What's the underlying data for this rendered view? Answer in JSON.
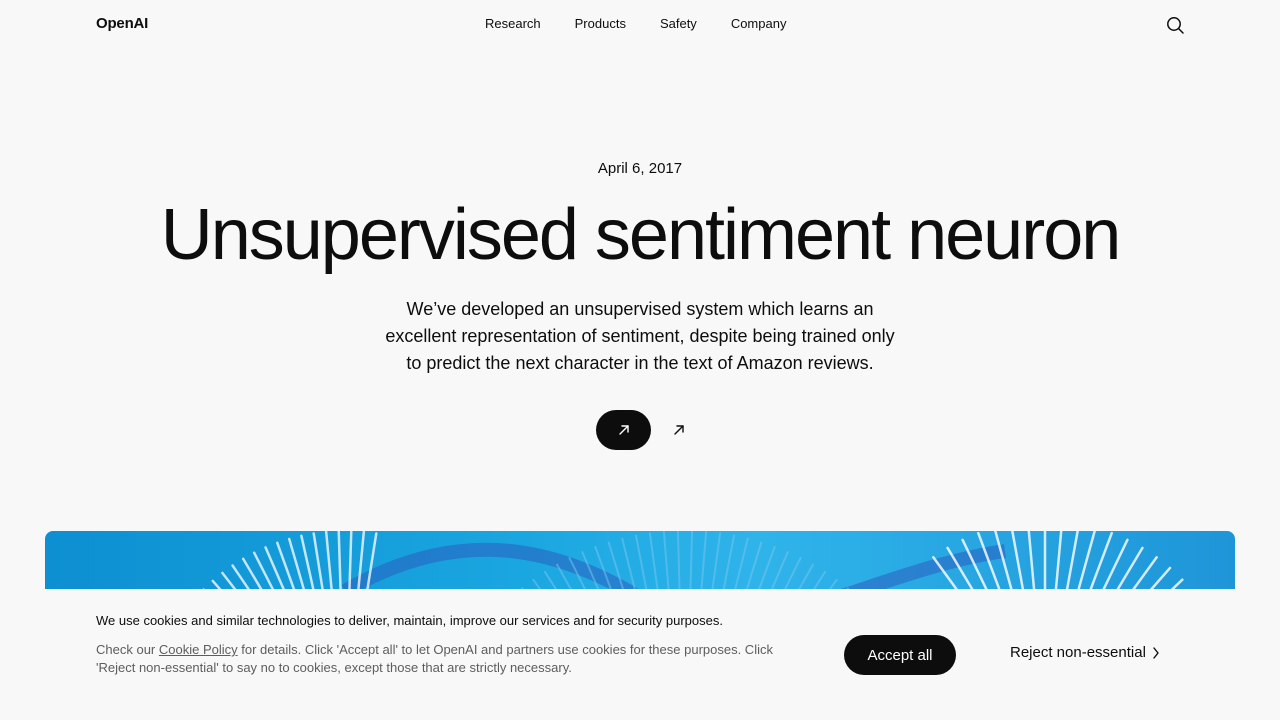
{
  "header": {
    "logo": "OpenAI",
    "nav": [
      "Research",
      "Products",
      "Safety",
      "Company"
    ],
    "search_icon": "search-icon"
  },
  "hero": {
    "date": "April 6, 2017",
    "title": "Unsupervised sentiment neuron",
    "subtitle": "We’ve developed an unsupervised system which learns an excellent representation of sentiment, despite being trained only to predict the next character in the text of Amazon reviews.",
    "primary_button_icon": "arrow-up-right-icon",
    "secondary_button_icon": "arrow-up-right-icon"
  },
  "cookie": {
    "heading": "We use cookies and similar technologies to deliver, maintain, improve our services and for security purposes.",
    "body_prefix": "Check our ",
    "policy_link": "Cookie Policy",
    "body_suffix": " for details. Click 'Accept all' to let OpenAI and partners use cookies for these purposes. Click 'Reject non-essential' to say no to cookies, except those that are strictly necessary.",
    "accept_label": "Accept all",
    "reject_label": "Reject non-essential",
    "reject_icon": "chevron-right-icon"
  },
  "colors": {
    "background": "#f8f8f8",
    "text": "#0d0d0d",
    "muted": "#5d5d5d",
    "banner_blue": "#1aa6e0"
  }
}
